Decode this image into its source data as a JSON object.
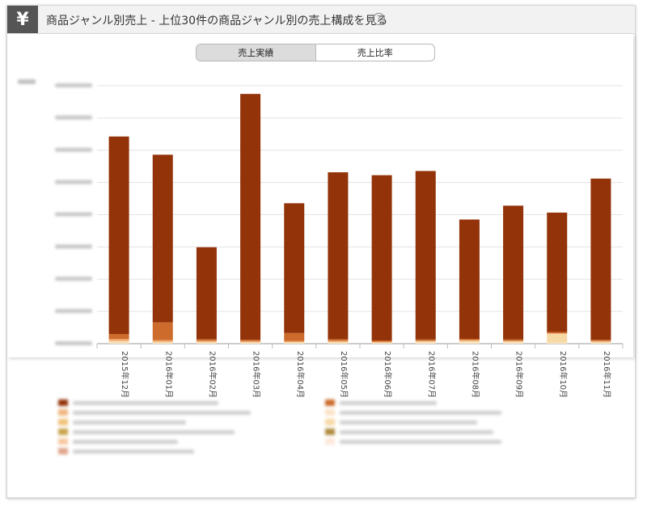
{
  "header": {
    "icon": "yen-icon",
    "icon_glyph": "¥",
    "title": "商品ジャンル別売上 - 上位30件の商品ジャンル別の売上構成を見る",
    "help_glyph": "?"
  },
  "toggle": {
    "options": [
      "売上実績",
      "売上比率"
    ],
    "selected": "売上実績"
  },
  "colors": {
    "main": "#93330a",
    "accent": "#cc6b2c"
  },
  "chart_data": {
    "type": "bar",
    "stacked": true,
    "categories": [
      "2015年12月",
      "2016年01月",
      "2016年02月",
      "2016年03月",
      "2016年04月",
      "2016年05月",
      "2016年06月",
      "2016年07月",
      "2016年08月",
      "2016年09月",
      "2016年10月",
      "2016年11月"
    ],
    "ylim": [
      0,
      1600000
    ],
    "grid": true,
    "legend_placement": "bottom",
    "series": [
      {
        "color": "#93330a",
        "values": [
          1225000,
          1040000,
          570000,
          1525000,
          805000,
          1035000,
          1025000,
          1045000,
          740000,
          830000,
          740000,
          1000000
        ]
      },
      {
        "color": "#cc6b2c",
        "values": [
          30000,
          110000,
          10000,
          8000,
          50000,
          10000,
          8000,
          8000,
          8000,
          8000,
          8000,
          8000
        ]
      },
      {
        "color": "#f0a46a",
        "values": [
          12000,
          10000,
          6000,
          6000,
          6000,
          6000,
          4000,
          4000,
          4000,
          4000,
          4000,
          4000
        ]
      },
      {
        "color": "#f7d9a6",
        "values": [
          12000,
          8000,
          8000,
          6000,
          6000,
          8000,
          5000,
          8000,
          10000,
          8000,
          55000,
          8000
        ]
      },
      {
        "color": "#fbe9c9",
        "values": [
          6000,
          4000,
          4000,
          4000,
          4000,
          4000,
          3000,
          6000,
          8000,
          6000,
          6000,
          4000
        ]
      }
    ]
  }
}
